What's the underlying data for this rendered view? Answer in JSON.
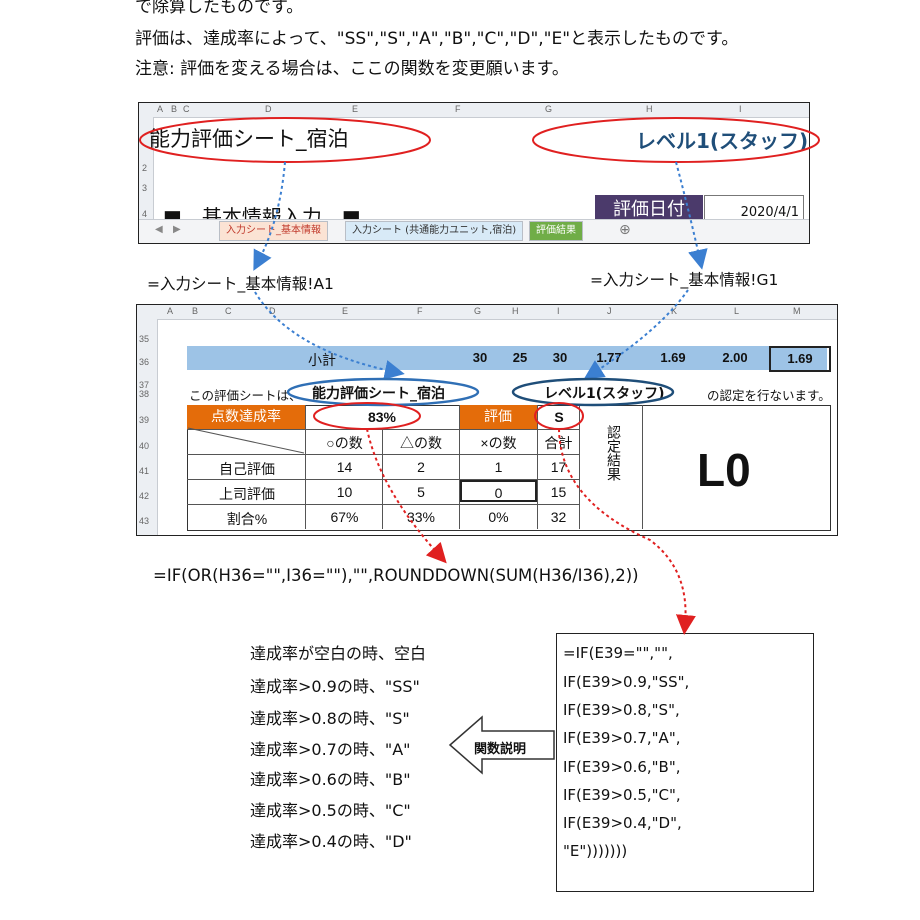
{
  "intro": {
    "line1": "で除算したものです。",
    "line2": "評価は、達成率によって、\"SS\",\"S\",\"A\",\"B\",\"C\",\"D\",\"E\"と表示したものです。",
    "line3": "注意: 評価を変える場合は、ここの関数を変更願います。"
  },
  "top_sheet": {
    "col_letters": [
      "A",
      "B",
      "C",
      "D",
      "E",
      "F",
      "G",
      "H",
      "I"
    ],
    "row_numbers": [
      "2",
      "3",
      "4"
    ],
    "title": "能力評価シート_宿泊",
    "level": "レベル1(スタッフ)",
    "basic_info": "■　基本情報入力　■",
    "eval_date_label": "評価日付",
    "eval_date_value": "2020/4/1",
    "tabs": [
      "入力シート_基本情報",
      "入力シート (共通能力ユニット,宿泊)",
      "評価結果"
    ],
    "add_tab": "⊕"
  },
  "ref_a1": "=入力シート_基本情報!A1",
  "ref_g1": "=入力シート_基本情報!G1",
  "bottom_sheet": {
    "col_letters": [
      "A",
      "B",
      "C",
      "D",
      "E",
      "F",
      "G",
      "H",
      "I",
      "J",
      "K",
      "L",
      "M"
    ],
    "row_numbers": [
      "35",
      "36",
      "37",
      "38",
      "39",
      "40",
      "41",
      "42",
      "43"
    ],
    "subtotal_label": "小計",
    "subtotal_values": [
      "30",
      "25",
      "30",
      "1.77",
      "1.69",
      "2.00",
      "1.69"
    ],
    "sentence_pre": "この評価シートは、",
    "sentence_title": "能力評価シート_宿泊",
    "sentence_level": "レベル1(スタッフ)",
    "sentence_post": "の認定を行ないます。",
    "rate_label": "点数達成率",
    "rate_value": "83%",
    "grade_label": "評価",
    "grade_value": "S",
    "headers": [
      "○の数",
      "△の数",
      "×の数",
      "合計"
    ],
    "rows": [
      {
        "label": "自己評価",
        "values": [
          "14",
          "2",
          "1",
          "17"
        ]
      },
      {
        "label": "上司評価",
        "values": [
          "10",
          "5",
          "0",
          "15"
        ]
      },
      {
        "label": "割合%",
        "values": [
          "67%",
          "33%",
          "0%",
          "32"
        ]
      }
    ],
    "cert_label": "認定結果",
    "cert_value": "L0"
  },
  "formula_rate": "=IF(OR(H36=\"\",I36=\"\"),\"\",ROUNDDOWN(SUM(H36/I36),2))",
  "rules": [
    "達成率が空白の時、空白",
    "達成率>0.9の時、\"SS\"",
    "達成率>0.8の時、\"S\"",
    "達成率>0.7の時、\"A\"",
    "達成率>0.6の時、\"B\"",
    "達成率>0.5の時、\"C\"",
    "達成率>0.4の時、\"D\""
  ],
  "explain_label": "関数説明",
  "formula_grade": [
    "=IF(E39=\"\",\"\",",
    "IF(E39>0.9,\"SS\",",
    "IF(E39>0.8,\"S\",",
    "IF(E39>0.7,\"A\",",
    "IF(E39>0.6,\"B\",",
    "IF(E39>0.5,\"C\",",
    "IF(E39>0.4,\"D\",",
    "\"E\")))))))"
  ],
  "colors": {
    "ellipse_red": "#e02020",
    "ellipse_blue": "#2f6fb5",
    "arrow_blue": "#3b7fd1",
    "arrow_red": "#e02020",
    "header_orange": "#e46c0a",
    "subtotal_blue": "#9dc3e6",
    "level_text": "#1f4e79",
    "eval_date_fill": "#4b3a6b"
  }
}
